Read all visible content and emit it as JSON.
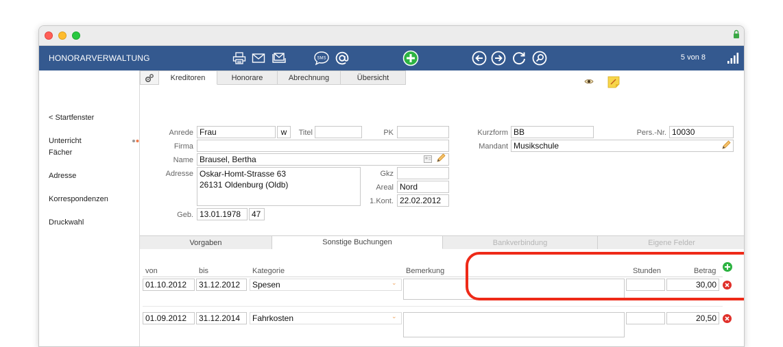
{
  "toolbar": {
    "title": "HONORARVERWALTUNG",
    "record_count": "5 von 8",
    "sms_label": "SMS"
  },
  "sidebar": {
    "items": [
      {
        "label": "< Startfenster"
      },
      {
        "label": "Unterricht"
      },
      {
        "label": "Fächer"
      },
      {
        "label": "Adresse"
      },
      {
        "label": "Korrespondenzen"
      },
      {
        "label": "Druckwahl"
      }
    ]
  },
  "tabs": [
    {
      "label": "Kreditoren",
      "active": true
    },
    {
      "label": "Honorare"
    },
    {
      "label": "Abrechnung"
    },
    {
      "label": "Übersicht"
    }
  ],
  "form": {
    "anrede_label": "Anrede",
    "anrede": "Frau",
    "gender": "w",
    "titel_label": "Titel",
    "titel": "",
    "pk_label": "PK",
    "pk": "",
    "firma_label": "Firma",
    "firma": "",
    "name_label": "Name",
    "name": "Brausel, Bertha",
    "adresse_label": "Adresse",
    "adresse_line1": "Oskar-Homt-Strasse 63",
    "adresse_line2": "26131 Oldenburg (Oldb)",
    "gkz_label": "Gkz",
    "gkz": "",
    "areal_label": "Areal",
    "areal": "Nord",
    "kont_label": "1.Kont.",
    "kont": "22.02.2012",
    "geb_label": "Geb.",
    "geb": "13.01.1978",
    "age": "47",
    "kurzform_label": "Kurzform",
    "kurzform": "BB",
    "persnr_label": "Pers.-Nr.",
    "persnr": "10030",
    "mandant_label": "Mandant",
    "mandant": "Musikschule"
  },
  "subtabs": [
    {
      "label": "Vorgaben"
    },
    {
      "label": "Sonstige Buchungen",
      "active": true
    },
    {
      "label": "Bankverbindung",
      "disabled": true
    },
    {
      "label": "Eigene Felder",
      "disabled": true
    }
  ],
  "bookings": {
    "headers": {
      "von": "von",
      "bis": "bis",
      "kategorie": "Kategorie",
      "bemerkung": "Bemerkung",
      "stunden": "Stunden",
      "betrag": "Betrag"
    },
    "rows": [
      {
        "von": "01.10.2012",
        "bis": "31.12.2012",
        "kategorie": "Spesen",
        "bemerkung": "",
        "stunden": "",
        "betrag": "30,00"
      },
      {
        "von": "01.09.2012",
        "bis": "31.12.2014",
        "kategorie": "Fahrkosten",
        "bemerkung": "",
        "stunden": "",
        "betrag": "20,50"
      }
    ]
  },
  "colors": {
    "toolbar_bg": "#34598f",
    "highlight": "#ee2a18",
    "delete": "#e0302a",
    "add": "#2db342"
  }
}
